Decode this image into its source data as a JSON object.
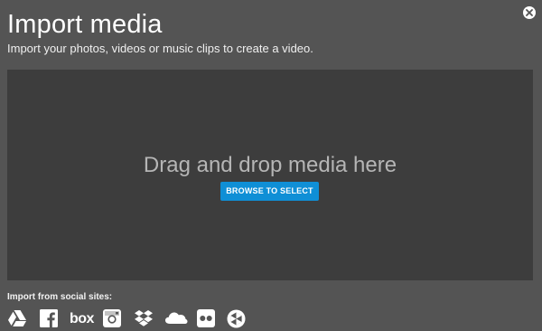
{
  "dialog": {
    "title": "Import media",
    "subtitle": "Import your photos, videos or music clips to create a video.",
    "close_icon": "close-icon"
  },
  "dropzone": {
    "prompt": "Drag and drop media here",
    "browse_label": "BROWSE TO SELECT",
    "browse_color": "#0f8fd6"
  },
  "social": {
    "label": "Import from social sites:",
    "sites": [
      {
        "name": "Google Drive",
        "icon": "google-drive-icon"
      },
      {
        "name": "Facebook",
        "icon": "facebook-icon"
      },
      {
        "name": "Box",
        "icon": "box-icon",
        "wordmark": "box"
      },
      {
        "name": "Instagram",
        "icon": "instagram-icon"
      },
      {
        "name": "Dropbox",
        "icon": "dropbox-icon"
      },
      {
        "name": "OneDrive",
        "icon": "onedrive-icon"
      },
      {
        "name": "Flickr",
        "icon": "flickr-icon"
      },
      {
        "name": "Picasa",
        "icon": "picasa-icon"
      }
    ]
  },
  "colors": {
    "background": "#545454",
    "dropzone": "#3d3d3d",
    "prompt_text": "#b5b5b5"
  }
}
